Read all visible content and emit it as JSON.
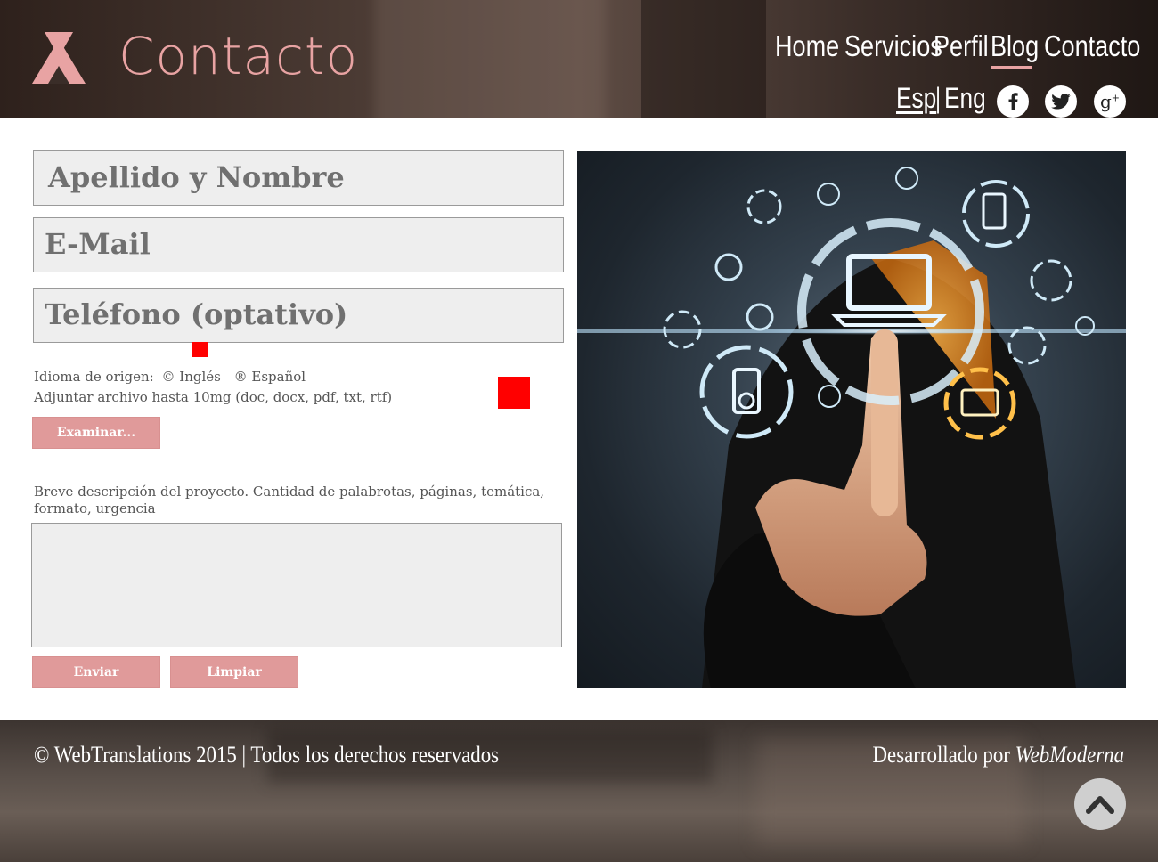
{
  "header": {
    "title": "Contacto",
    "nav": [
      "Home",
      "Servicios",
      "Perfil",
      "Blog",
      "Contacto"
    ],
    "lang_esp": "Esp",
    "lang_sep": "|",
    "lang_eng": "Eng",
    "social": [
      "facebook-icon",
      "twitter-icon",
      "google-plus-icon"
    ],
    "accent": "#e8a3a3"
  },
  "form": {
    "name_placeholder": "Apellido y Nombre",
    "email_placeholder": "E-Mail",
    "phone_placeholder": "Teléfono (optativo)",
    "origin_label": "Idioma de origen:",
    "origin_option_en": "© Inglés",
    "origin_option_es": "® Español",
    "attach_label": "Adjuntar archivo hasta 10mg (doc, docx, pdf, txt, rtf)",
    "browse_label": "Examinar...",
    "description_label": "Breve descripción del proyecto. Cantidad de palabrotas, páginas, temática, formato, urgencia",
    "send_label": "Enviar",
    "clear_label": "Limpiar"
  },
  "footer": {
    "copyright": "© WebTranslations 2015 | Todos los derechos reservados",
    "dev_prefix": "Desarrollado por",
    "dev_name": "WebModerna"
  }
}
